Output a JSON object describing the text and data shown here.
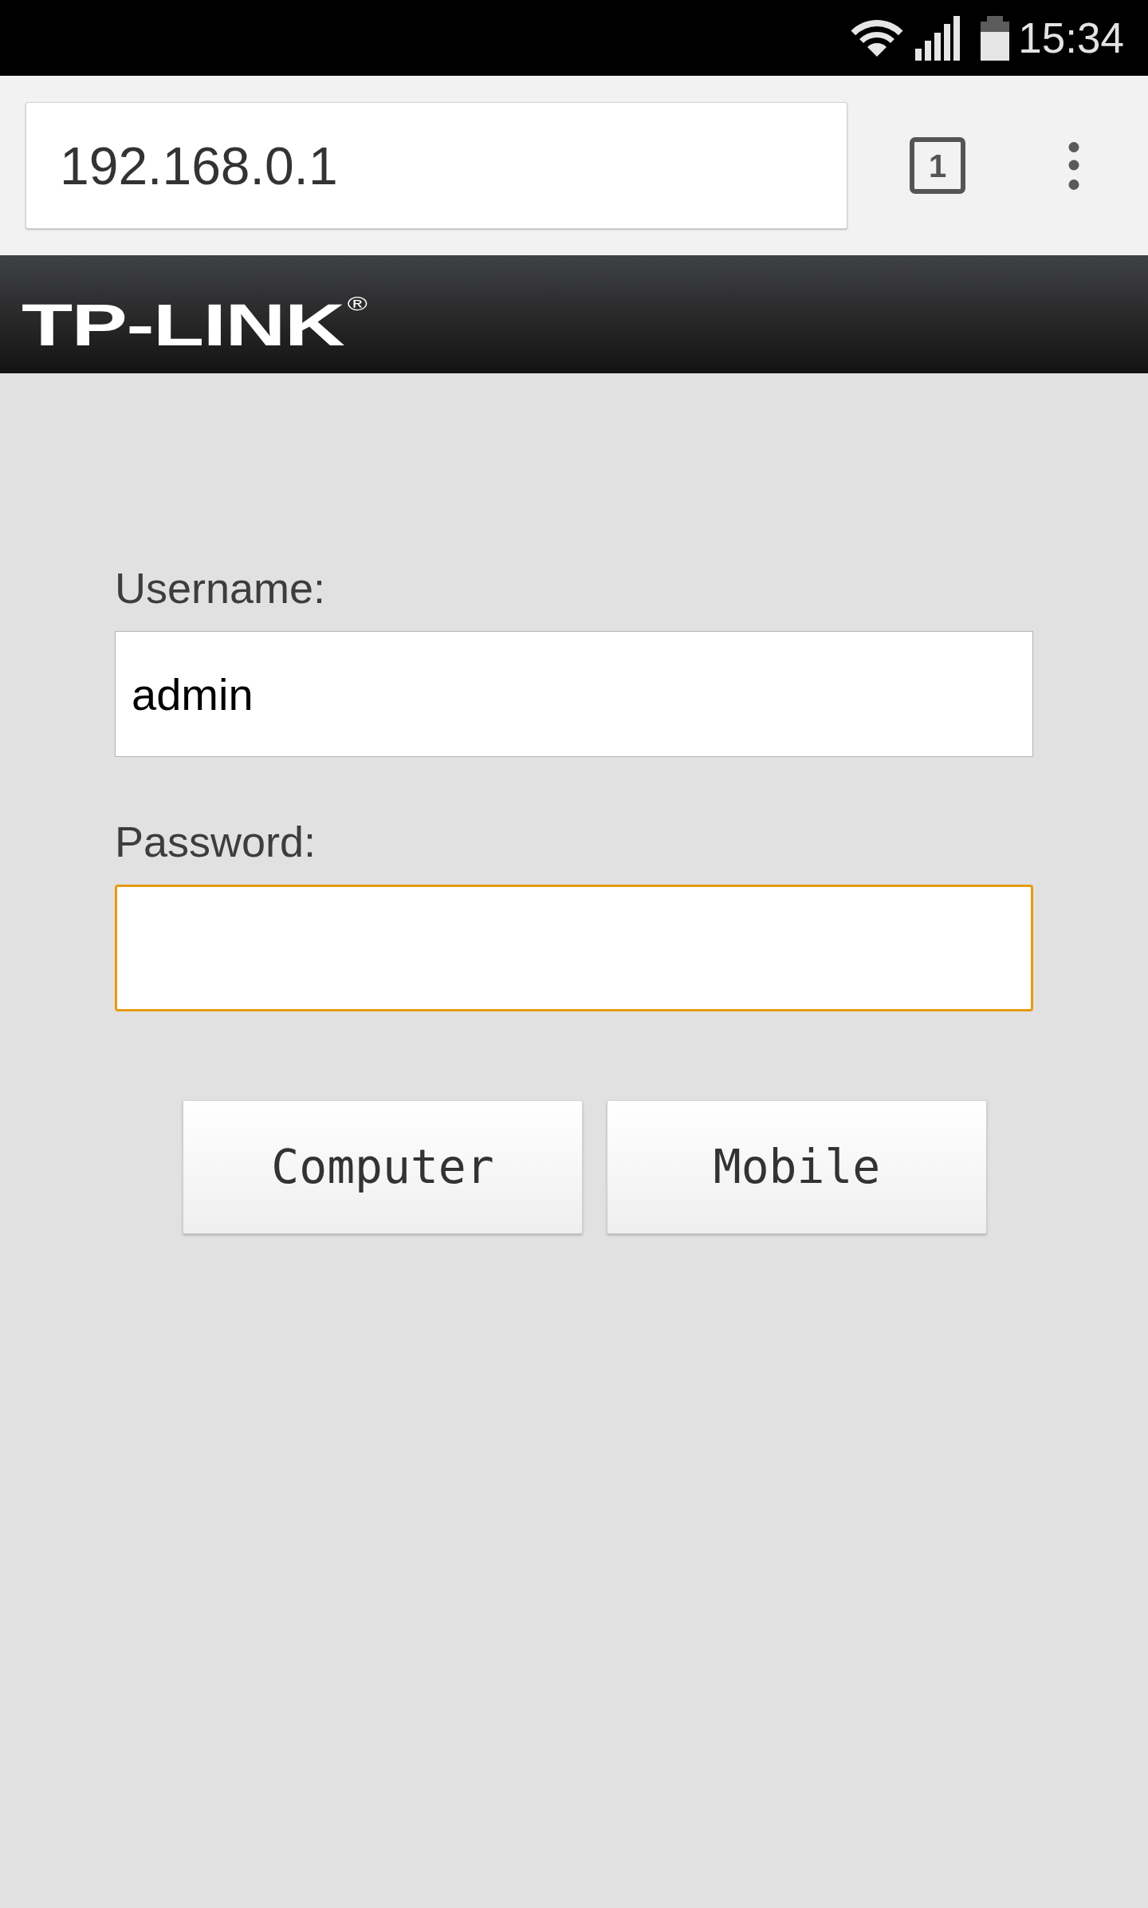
{
  "status_bar": {
    "time": "15:34"
  },
  "browser_toolbar": {
    "url": "192.168.0.1",
    "tab_count": "1"
  },
  "header": {
    "logo": "TP-LINK$^{®}$"
  },
  "login_form": {
    "fields": [
      {
        "label": "Username:",
        "value": "admin",
        "focused": false
      },
      {
        "label": "Password:",
        "focused": true
      }
    ],
    "buttons": [
      "Computer",
      "Mobile"
    ]
  }
}
